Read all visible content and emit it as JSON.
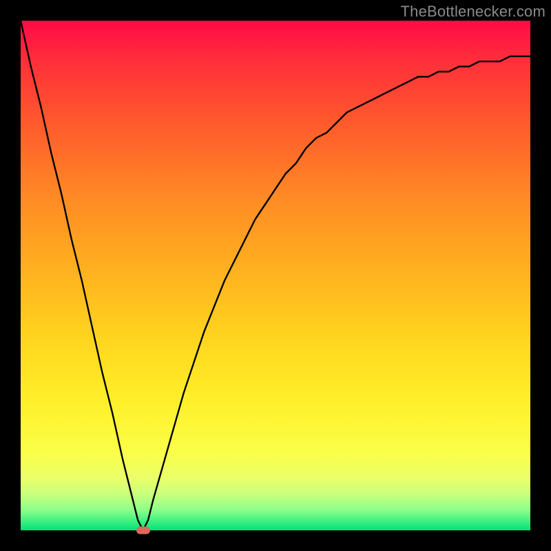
{
  "attribution": "TheBottlenecker.com",
  "chart_data": {
    "type": "line",
    "title": "",
    "xlabel": "",
    "ylabel": "",
    "xlim": [
      0,
      100
    ],
    "ylim": [
      0,
      100
    ],
    "legend": false,
    "grid": false,
    "series": [
      {
        "name": "bottleneck-curve",
        "x": [
          0,
          2,
          4,
          6,
          8,
          10,
          12,
          14,
          16,
          18,
          20,
          22,
          23,
          24,
          25,
          26,
          28,
          30,
          32,
          34,
          36,
          38,
          40,
          42,
          44,
          46,
          48,
          50,
          52,
          54,
          56,
          58,
          60,
          62,
          64,
          66,
          68,
          70,
          72,
          74,
          76,
          78,
          80,
          82,
          84,
          86,
          88,
          90,
          92,
          94,
          96,
          98,
          100
        ],
        "y": [
          100,
          91,
          83,
          74,
          66,
          57,
          49,
          40,
          31,
          23,
          14,
          6,
          2,
          0,
          2,
          6,
          13,
          20,
          27,
          33,
          39,
          44,
          49,
          53,
          57,
          61,
          64,
          67,
          70,
          72,
          75,
          77,
          78,
          80,
          82,
          83,
          84,
          85,
          86,
          87,
          88,
          89,
          89,
          90,
          90,
          91,
          91,
          92,
          92,
          92,
          93,
          93,
          93
        ]
      }
    ],
    "annotations": [
      {
        "name": "min-marker",
        "x": 24,
        "y": 0
      }
    ],
    "background_gradient": {
      "top": "#ff0b46",
      "bottom": "#00e37a"
    }
  }
}
